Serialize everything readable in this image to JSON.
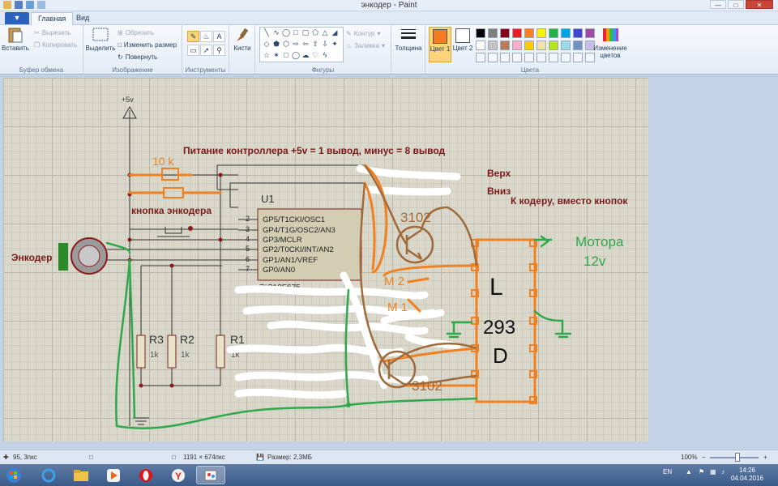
{
  "window": {
    "title": "энкодер - Paint"
  },
  "tabs": {
    "file": "",
    "home": "Главная",
    "view": "Вид"
  },
  "ribbon": {
    "clipboard": {
      "label": "Буфер обмена",
      "paste": "Вставить",
      "cut": "Вырезать",
      "copy": "Копировать"
    },
    "image": {
      "label": "Изображение",
      "select": "Выделить",
      "crop": "Обрезать",
      "resize": "Изменить размер",
      "rotate": "Повернуть"
    },
    "tools": {
      "label": "Инструменты"
    },
    "brushes": {
      "label": "Кисти"
    },
    "shapes": {
      "label": "Фигуры",
      "outline": "Контур",
      "fill": "Заливка"
    },
    "size": {
      "label": "Толщина"
    },
    "colors": {
      "label": "Цвета",
      "color1": "Цвет 1",
      "color2": "Цвет 2",
      "edit": "Изменение цветов",
      "color1_value": "#f47c20",
      "color2_value": "#ffffff"
    },
    "palette": [
      "#000000",
      "#7f7f7f",
      "#880015",
      "#ed1c24",
      "#ff7f27",
      "#fff200",
      "#22b14c",
      "#00a2e8",
      "#3f48cc",
      "#a349a4",
      "#ffffff",
      "#c3c3c3",
      "#b97a57",
      "#ffaec9",
      "#ffc90e",
      "#efe4b0",
      "#b5e61d",
      "#99d9ea",
      "#7092be",
      "#c8bfe7"
    ]
  },
  "drawing": {
    "vcc": "+5v",
    "note_power": "Питание контроллера +5v = 1 вывод, минус = 8 вывод",
    "label_up": "Верх",
    "label_down": "Вниз",
    "label_coder": "К кодеру, вместо кнопок",
    "label_button": "кнопка энкодера",
    "label_encoder": "Энкодер",
    "chip_ref": "U1",
    "chip_name": "PIC12F675",
    "pins": [
      "GP5/T1CKI/OSC1",
      "GP4/T1G/OSC2/AN3",
      "GP3/MCLR",
      "GP2/T0CKI/INT/AN2",
      "GP1/AN1/VREF",
      "GP0/AN0"
    ],
    "pin_numbers": [
      "2",
      "3",
      "4",
      "5",
      "6",
      "7"
    ],
    "r3": "R3",
    "r2": "R2",
    "r1": "R1",
    "r_value": "1k",
    "res_10k": "10 k",
    "t1": "3102",
    "t2": "3102",
    "m2": "M 2",
    "m1": "M 1",
    "driver_l": "L",
    "driver_293": "293",
    "driver_d": "D",
    "motor_note_1": "Мотора",
    "motor_note_2": "12v"
  },
  "status": {
    "cursor": "95, 3пкс",
    "size": "1191 × 674пкс",
    "filesize": "Размер: 2,3МБ",
    "zoom": "100%"
  },
  "taskbar": {
    "lang": "EN",
    "time": "14:26",
    "date": "04.04.2016"
  }
}
